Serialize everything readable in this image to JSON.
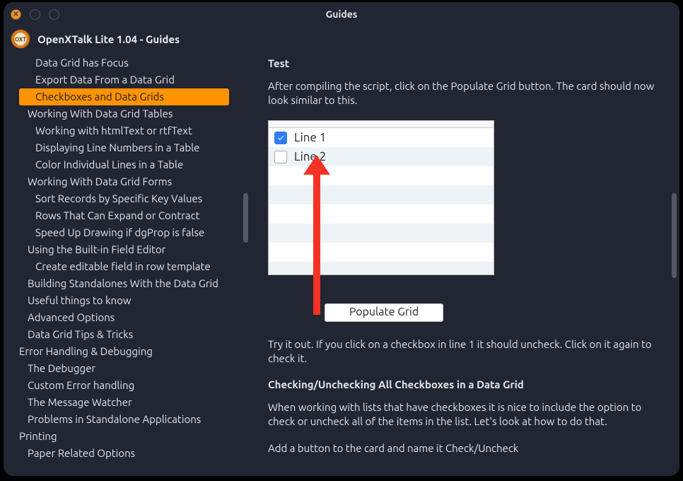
{
  "window": {
    "title": "Guides",
    "subtitle": "OpenXTalk Lite 1.04 - Guides"
  },
  "sidebar": {
    "items": [
      {
        "label": "Data Grid has Focus",
        "level": 3
      },
      {
        "label": "Export Data From a Data Grid",
        "level": 3
      },
      {
        "label": "Checkboxes and Data Grids",
        "level": 3,
        "selected": true
      },
      {
        "label": "Working With Data Grid Tables",
        "level": 2
      },
      {
        "label": "Working with htmlText or rtfText",
        "level": 3
      },
      {
        "label": "Displaying Line Numbers in a Table",
        "level": 3
      },
      {
        "label": "Color Individual Lines in a Table",
        "level": 3
      },
      {
        "label": "Working With Data Grid Forms",
        "level": 2
      },
      {
        "label": "Sort Records by Specific Key Values",
        "level": 3
      },
      {
        "label": "Rows That Can Expand or Contract",
        "level": 3
      },
      {
        "label": "Speed Up Drawing if dgProp is false",
        "level": 3
      },
      {
        "label": "Using the Built-in Field Editor",
        "level": 2
      },
      {
        "label": "Create editable field in row template",
        "level": 3
      },
      {
        "label": "Building Standalones With the Data Grid",
        "level": 2
      },
      {
        "label": "Useful things to know",
        "level": 2
      },
      {
        "label": "Advanced Options",
        "level": 2
      },
      {
        "label": "Data Grid Tips & Tricks",
        "level": 2
      },
      {
        "label": "Error Handling & Debugging",
        "level": 1
      },
      {
        "label": "The Debugger",
        "level": 2
      },
      {
        "label": "Custom Error handling",
        "level": 2
      },
      {
        "label": "The Message Watcher",
        "level": 2
      },
      {
        "label": "Problems in Standalone Applications",
        "level": 2
      },
      {
        "label": "Printing",
        "level": 1
      },
      {
        "label": "Paper Related Options",
        "level": 2
      }
    ]
  },
  "content": {
    "h_test": "Test",
    "p_compile": "After compiling the script, click on the Populate Grid button. The card should now look similar to this.",
    "grid": {
      "rows": [
        {
          "checked": true,
          "label": "Line 1"
        },
        {
          "checked": false,
          "label": "Line 2"
        }
      ],
      "button_label": "Populate Grid"
    },
    "p_tryit": "Try it out. If you click on a checkbox in line 1 it should uncheck. Click on it again to check it.",
    "h_checkall": "Checking/Unchecking All Checkboxes in a Data Grid",
    "p_checkall": "When working with lists that have checkboxes it is nice to include the option to check or uncheck all of the items in the list. Let's look at how to do that.",
    "p_addbtn": "Add a button to the card and name it Check/Uncheck"
  }
}
